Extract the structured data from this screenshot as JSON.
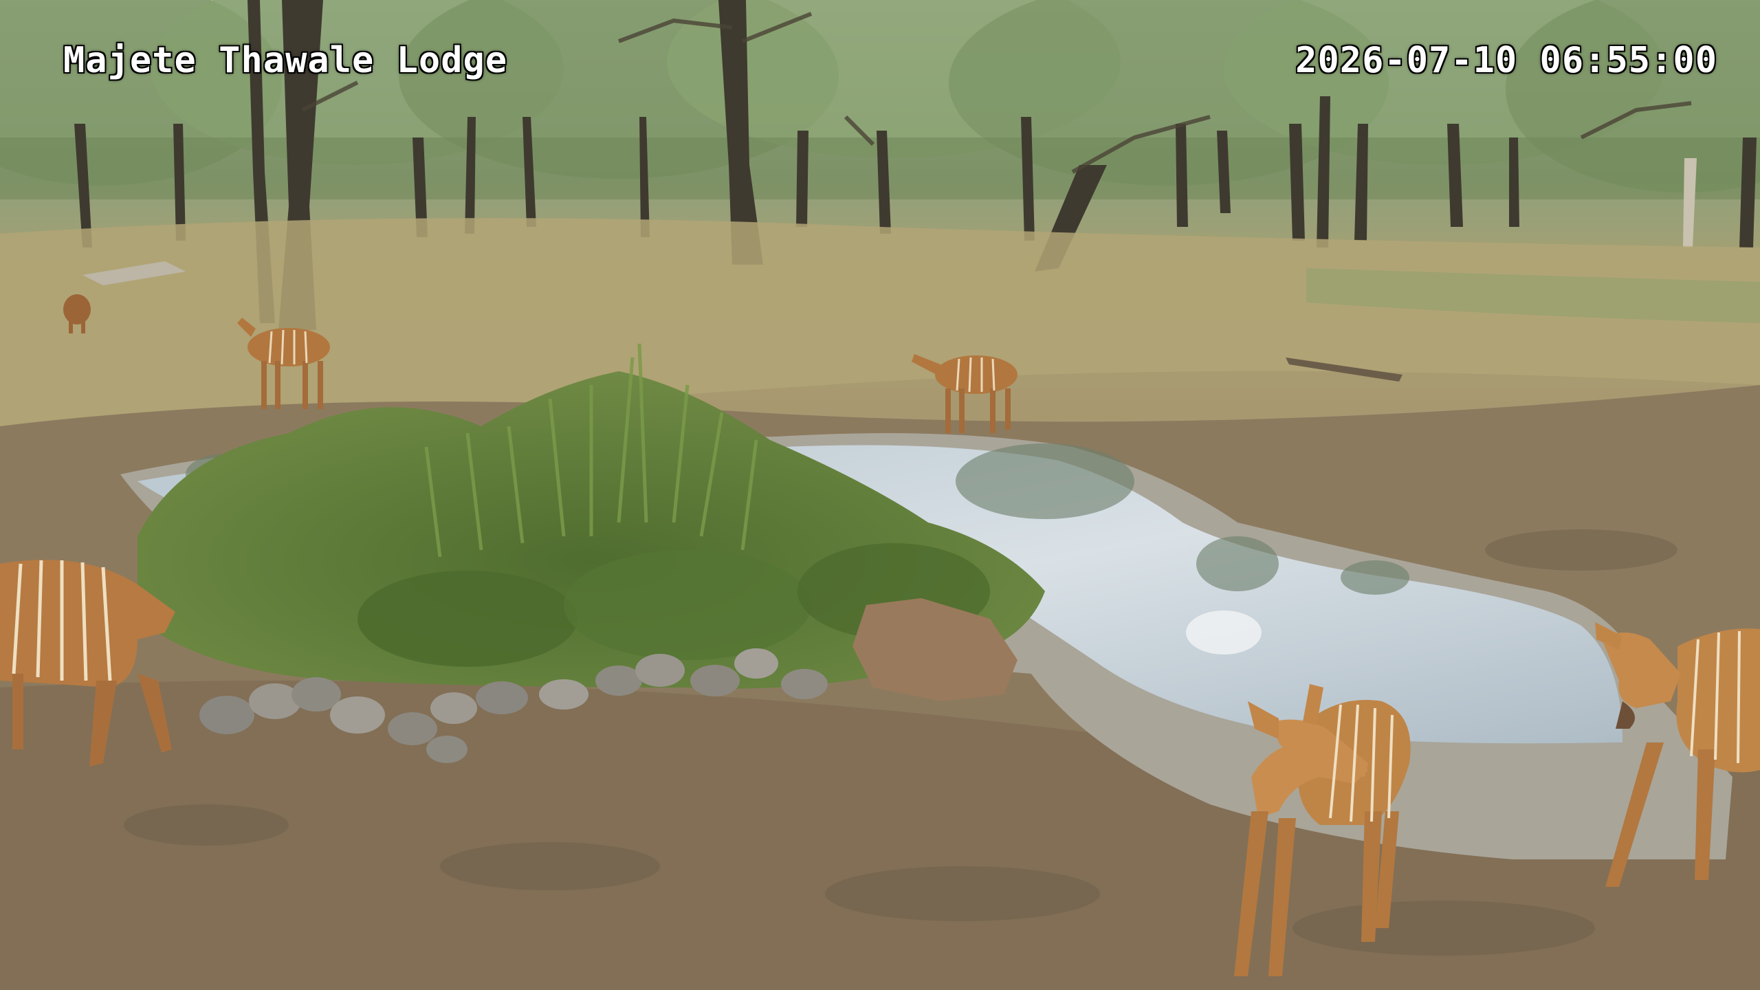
{
  "camera": {
    "location_label": "Majete Thawale Lodge",
    "timestamp": "2026-07-10 06:55:00"
  },
  "scene": {
    "subjects": [
      {
        "name": "nyala-left-foreground",
        "kind": "nyala"
      },
      {
        "name": "nyala-young-center-right",
        "kind": "nyala"
      },
      {
        "name": "nyala-adult-right-edge",
        "kind": "nyala"
      },
      {
        "name": "nyala-midground-center",
        "kind": "nyala"
      },
      {
        "name": "nyala-midground-left",
        "kind": "nyala"
      },
      {
        "name": "nyala-far-left",
        "kind": "nyala"
      }
    ],
    "features": [
      "waterhole",
      "concrete-rim",
      "reeds-bush",
      "rocks",
      "woodland",
      "dry-grass",
      "dirt-ground"
    ]
  },
  "colors": {
    "sky_haze": "#c9cfc4",
    "canopy": "#6f8a5a",
    "grass": "#a99d6c",
    "ground": "#8c7a5e",
    "water": "#cfd8de",
    "concrete": "#a8a499",
    "bush": "#5d7a3a",
    "nyala_coat": "#b6773f",
    "osd_text": "#ffffff"
  }
}
